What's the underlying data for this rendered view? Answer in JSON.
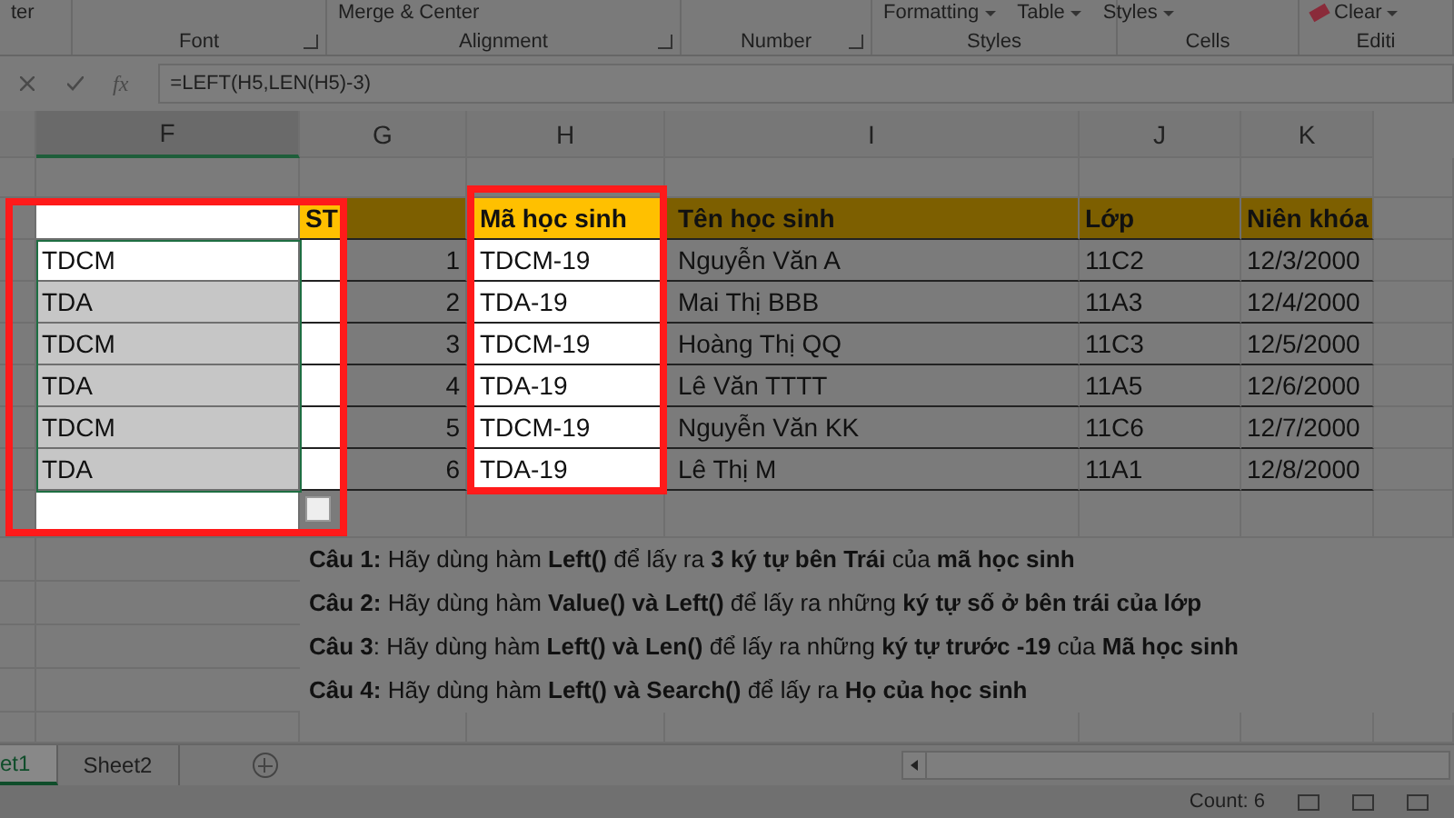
{
  "ribbon": {
    "groups": [
      {
        "buttons": [
          "ter"
        ]
      },
      {
        "label": "Font"
      },
      {
        "label": "Alignment",
        "buttons": [
          "Merge & Center"
        ]
      },
      {
        "label": "Number"
      },
      {
        "kind": "dropdowns",
        "label": "Styles",
        "buttons": [
          "Formatting",
          "Table",
          "Styles"
        ]
      },
      {
        "label": "Cells"
      },
      {
        "kind": "eraser",
        "label": "Editi",
        "buttons": [
          "Clear"
        ]
      }
    ]
  },
  "formula_bar": {
    "function_label": "fx",
    "formula": "=LEFT(H5,LEN(H5)-3)"
  },
  "columns": [
    {
      "label": "F",
      "selected": true
    },
    {
      "label": "G",
      "selected": false
    },
    {
      "label": "H",
      "selected": false
    },
    {
      "label": "I",
      "selected": false
    },
    {
      "label": "J",
      "selected": false
    },
    {
      "label": "K",
      "selected": false
    }
  ],
  "table": {
    "headers": [
      "ST",
      "Mã học sinh",
      "Tên học sinh",
      "Lớp",
      "Niên khóa"
    ],
    "rows": [
      {
        "result": "TDCM",
        "active": true,
        "stt": "1",
        "code": "TDCM-19",
        "name": "Nguyễn Văn A",
        "class": "11C2",
        "year": "12/3/2000"
      },
      {
        "result": "TDA",
        "active": false,
        "stt": "2",
        "code": "TDA-19",
        "name": "Mai Thị BBB",
        "class": "11A3",
        "year": "12/4/2000"
      },
      {
        "result": "TDCM",
        "active": false,
        "stt": "3",
        "code": "TDCM-19",
        "name": "Hoàng Thị QQ",
        "class": "11C3",
        "year": "12/5/2000"
      },
      {
        "result": "TDA",
        "active": false,
        "stt": "4",
        "code": "TDA-19",
        "name": "Lê Văn TTTT",
        "class": "11A5",
        "year": "12/6/2000"
      },
      {
        "result": "TDCM",
        "active": false,
        "stt": "5",
        "code": "TDCM-19",
        "name": "Nguyễn Văn KK",
        "class": "11C6",
        "year": "12/7/2000"
      },
      {
        "result": "TDA",
        "active": false,
        "stt": "6",
        "code": "TDA-19",
        "name": "Lê Thị M",
        "class": "11A1",
        "year": "12/8/2000"
      }
    ]
  },
  "questions": [
    "**Câu 1:** Hãy dùng hàm **Left()** để lấy ra **3 ký tự bên Trái** của **mã học sinh**",
    "**Câu 2:** Hãy dùng hàm **Value() và Left()** để lấy ra những **ký tự số ở bên trái của lớp**",
    "**Câu 3**: Hãy dùng hàm **Left() và Len()** để lấy ra  những **ký tự trước -19** của **Mã học sinh**",
    "**Câu 4:** Hãy dùng hàm **Left() và Search()** để lấy ra **Họ của học sinh**"
  ],
  "sheet_tabs": [
    {
      "label": "et1",
      "selected": true
    },
    {
      "label": "Sheet2",
      "selected": false
    }
  ],
  "status_bar": {
    "count": "Count: 6"
  }
}
